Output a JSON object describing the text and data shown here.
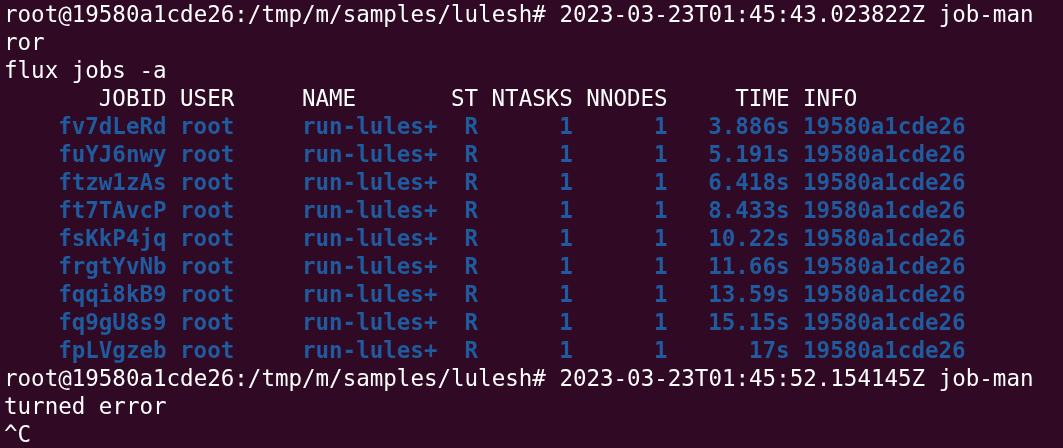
{
  "terminal": {
    "lines_before": [
      {
        "text": "root@19580a1cde26:/tmp/m/samples/lulesh# 2023-03-23T01:45:43.023822Z job-man"
      },
      {
        "text": "ror"
      },
      {
        "text": "flux jobs -a"
      }
    ],
    "table": {
      "columns": [
        "JOBID",
        "USER",
        "NAME",
        "ST",
        "NTASKS",
        "NNODES",
        "TIME",
        "INFO"
      ],
      "rows": [
        [
          "fv7dLeRd",
          "root",
          "run-lules+",
          "R",
          "1",
          "1",
          "3.886s",
          "19580a1cde26"
        ],
        [
          "fuYJ6nwy",
          "root",
          "run-lules+",
          "R",
          "1",
          "1",
          "5.191s",
          "19580a1cde26"
        ],
        [
          "ftzw1zAs",
          "root",
          "run-lules+",
          "R",
          "1",
          "1",
          "6.418s",
          "19580a1cde26"
        ],
        [
          "ft7TAvcP",
          "root",
          "run-lules+",
          "R",
          "1",
          "1",
          "8.433s",
          "19580a1cde26"
        ],
        [
          "fsKkP4jq",
          "root",
          "run-lules+",
          "R",
          "1",
          "1",
          "10.22s",
          "19580a1cde26"
        ],
        [
          "frgtYvNb",
          "root",
          "run-lules+",
          "R",
          "1",
          "1",
          "11.66s",
          "19580a1cde26"
        ],
        [
          "fqqi8kB9",
          "root",
          "run-lules+",
          "R",
          "1",
          "1",
          "13.59s",
          "19580a1cde26"
        ],
        [
          "fq9gU8s9",
          "root",
          "run-lules+",
          "R",
          "1",
          "1",
          "15.15s",
          "19580a1cde26"
        ],
        [
          "fpLVgzeb",
          "root",
          "run-lules+",
          "R",
          "1",
          "1",
          "17s",
          "19580a1cde26"
        ]
      ]
    },
    "lines_after": [
      {
        "text": "root@19580a1cde26:/tmp/m/samples/lulesh# 2023-03-23T01:45:52.154145Z job-man"
      },
      {
        "text": "turned error"
      },
      {
        "text": "^C"
      }
    ]
  }
}
